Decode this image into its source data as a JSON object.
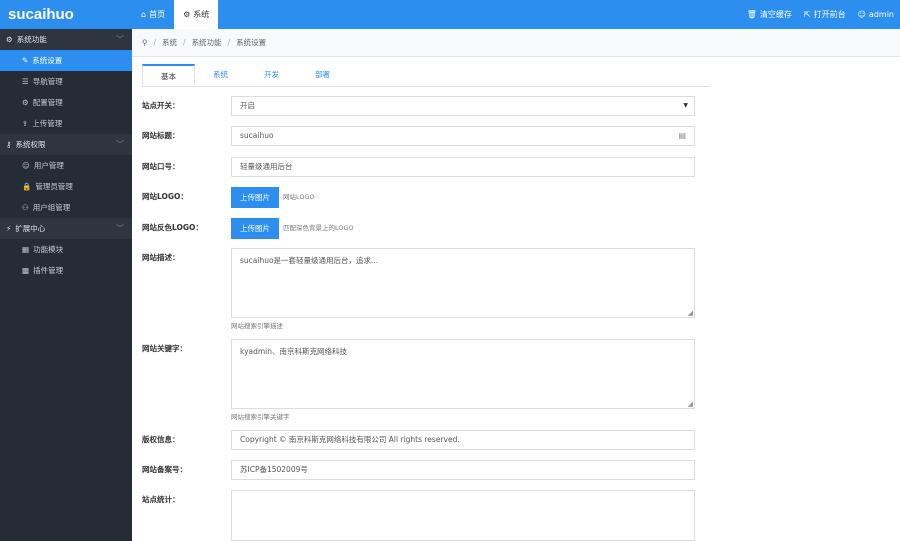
{
  "brand": "sucaihuo",
  "topnav": [
    {
      "icon": "home-icon",
      "label": "首页"
    },
    {
      "icon": "gear-icon",
      "label": "系统"
    }
  ],
  "topright": {
    "clear_cache": "清空缓存",
    "open_frontend": "打开前台",
    "user": "admin"
  },
  "sidebar": {
    "groups": [
      {
        "label": "系统功能",
        "items": [
          "系统设置",
          "导航管理",
          "配置管理",
          "上传管理"
        ]
      },
      {
        "label": "系统权限",
        "items": [
          "用户管理",
          "管理员管理",
          "用户组管理"
        ]
      },
      {
        "label": "扩展中心",
        "items": [
          "功能模块",
          "插件管理"
        ]
      }
    ],
    "active_item": "系统设置"
  },
  "breadcrumb": [
    "系统",
    "系统功能",
    "系统设置"
  ],
  "tabs": [
    "基本",
    "系统",
    "开发",
    "部署"
  ],
  "form": {
    "site_switch_label": "站点开关：",
    "site_switch_value": "开启",
    "site_title_label": "网站标题：",
    "site_title_value": "sucaihuo",
    "site_slogan_label": "网站口号：",
    "site_slogan_value": "轻量级通用后台",
    "logo_label": "网站LOGO：",
    "logo_button": "上传图片",
    "logo_hint": "网站LOGO",
    "logo_inverse_label": "网站反色LOGO：",
    "logo_inverse_button": "上传图片",
    "logo_inverse_hint": "匹配深色背景上的LOGO",
    "description_label": "网站描述：",
    "description_value": "sucaihuo是一套轻量级通用后台，追求...",
    "description_help": "网站搜索引擎描述",
    "keywords_label": "网站关键字：",
    "keywords_value": "kyadmin、南京科斯克网络科技",
    "keywords_help": "网站搜索引擎关键字",
    "copyright_label": "版权信息：",
    "copyright_value": "Copyright © 南京科斯克网络科技有限公司 All rights reserved.",
    "icp_label": "网站备案号：",
    "icp_value": "苏ICP备1502009号",
    "stats_label": "站点统计："
  },
  "colors": {
    "accent": "#2c8ff0",
    "sidebar": "#262c36"
  }
}
